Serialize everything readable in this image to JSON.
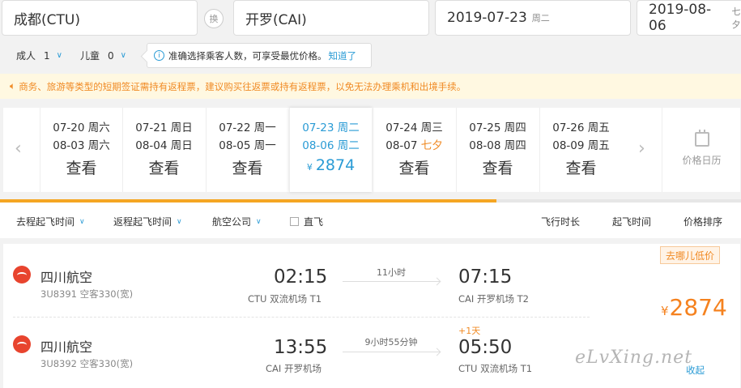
{
  "search": {
    "origin": "成都(CTU)",
    "swap_label": "换",
    "destination": "开罗(CAI)",
    "depart_date": "2019-07-23",
    "depart_weekday": "周二",
    "return_date": "2019-08-06",
    "return_weekday": "七夕"
  },
  "passengers": {
    "adult_label": "成人",
    "adult_count": "1",
    "child_label": "儿童",
    "child_count": "0",
    "tip_text": "准确选择乘客人数，可享受最优价格。",
    "tip_link": "知道了"
  },
  "notice": "商务、旅游等类型的短期签证需持有返程票，建议购买往返票或持有返程票，以免无法办理乘机和出境手续。",
  "date_strip": {
    "cells": [
      {
        "out": "07-20 周六",
        "ret": "08-03 周六",
        "action": "查看"
      },
      {
        "out": "07-21 周日",
        "ret": "08-04 周日",
        "action": "查看"
      },
      {
        "out": "07-22 周一",
        "ret": "08-05 周一",
        "action": "查看"
      },
      {
        "out": "07-23 周二",
        "ret": "08-06 周二",
        "price_symbol": "¥",
        "price": "2874"
      },
      {
        "out": "07-24 周三",
        "ret_date": "08-07",
        "ret_holiday": "七夕",
        "action": "查看"
      },
      {
        "out": "07-25 周四",
        "ret": "08-08 周四",
        "action": "查看"
      },
      {
        "out": "07-26 周五",
        "ret": "08-09 周五",
        "action": "查看"
      }
    ],
    "calendar_label": "价格日历"
  },
  "progress": 0.67,
  "filters": {
    "depart_time": "去程起飞时间",
    "return_time": "返程起飞时间",
    "airline": "航空公司",
    "direct": "直飞",
    "sort_duration": "飞行时长",
    "sort_departure": "起飞时间",
    "sort_price": "价格排序"
  },
  "result": {
    "badge": "去哪儿低价",
    "price_symbol": "¥",
    "price": "2874",
    "collapse": "收起",
    "watermark": "eLvXing.net",
    "legs": [
      {
        "airline": "四川航空",
        "flight": "3U8391 空客330(宽)",
        "dep_time": "02:15",
        "dep_airport": "CTU 双流机场 T1",
        "duration": "11小时",
        "arr_time": "07:15",
        "arr_airport": "CAI 开罗机场 T2",
        "day_offset": ""
      },
      {
        "airline": "四川航空",
        "flight": "3U8392 空客330(宽)",
        "dep_time": "13:55",
        "dep_airport": "CAI 开罗机场",
        "duration": "9小时55分钟",
        "arr_time": "05:50",
        "arr_airport": "CTU 双流机场 T1",
        "day_offset": "+1天"
      }
    ]
  },
  "colors": {
    "accent_blue": "#2a9bd5",
    "accent_orange": "#f5821f",
    "progress": "#f5a623"
  }
}
